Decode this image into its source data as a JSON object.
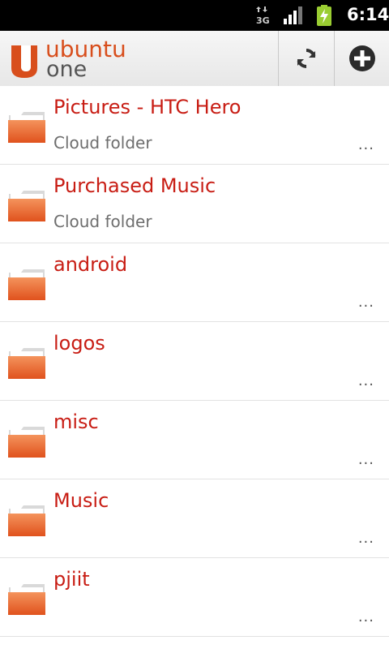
{
  "status_bar": {
    "network_type": "3G",
    "time": "6:14",
    "battery_state": "charging"
  },
  "header": {
    "logo_word1": "ubuntu",
    "logo_word2": "one",
    "sync_icon": "sync-icon",
    "add_icon": "add-icon"
  },
  "folders": [
    {
      "name": "Pictures - HTC Hero",
      "subtitle": "Cloud folder",
      "more": "..."
    },
    {
      "name": "Purchased Music",
      "subtitle": "Cloud folder",
      "more": ""
    },
    {
      "name": "android",
      "subtitle": "",
      "more": "..."
    },
    {
      "name": "logos",
      "subtitle": "",
      "more": "..."
    },
    {
      "name": "misc",
      "subtitle": "",
      "more": "..."
    },
    {
      "name": "Music",
      "subtitle": "",
      "more": "..."
    },
    {
      "name": "pjiit",
      "subtitle": "",
      "more": "..."
    }
  ],
  "colors": {
    "accent": "#c81d14",
    "brand_orange": "#d84e1c",
    "folder_orange": "#e8652a"
  }
}
